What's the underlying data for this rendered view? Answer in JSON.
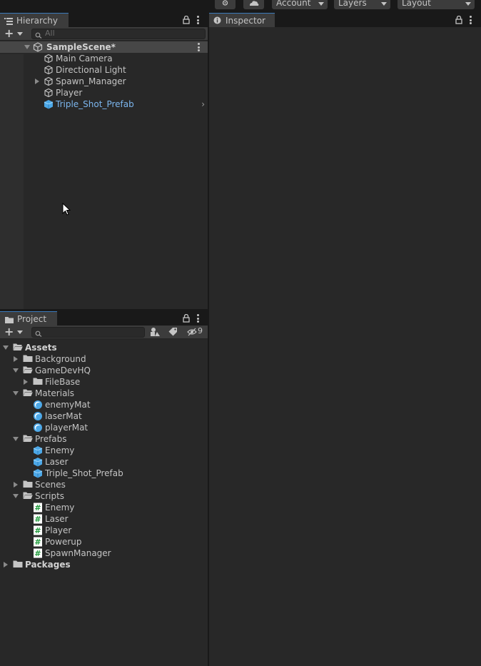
{
  "topbar": {
    "account_label": "Account",
    "layers_label": "Layers",
    "layout_label": "Layout",
    "icons": [
      "collab-icon",
      "cloud-icon"
    ]
  },
  "hierarchy": {
    "tab_label": "Hierarchy",
    "search_placeholder": "All",
    "scene_name": "SampleScene*",
    "items": [
      {
        "label": "Main Camera",
        "icon": "gameobject-icon",
        "expandable": false,
        "prefab": false
      },
      {
        "label": "Directional Light",
        "icon": "gameobject-icon",
        "expandable": false,
        "prefab": false
      },
      {
        "label": "Spawn_Manager",
        "icon": "gameobject-icon",
        "expandable": true,
        "prefab": false
      },
      {
        "label": "Player",
        "icon": "gameobject-icon",
        "expandable": false,
        "prefab": false
      },
      {
        "label": "Triple_Shot_Prefab",
        "icon": "prefab-icon",
        "expandable": false,
        "prefab": true
      }
    ]
  },
  "inspector": {
    "tab_label": "Inspector"
  },
  "project": {
    "tab_label": "Project",
    "hidden_count": "9",
    "tree": [
      {
        "label": "Assets",
        "depth": 0,
        "type": "folder-open",
        "fold": "down",
        "bold": true
      },
      {
        "label": "Background",
        "depth": 1,
        "type": "folder",
        "fold": "right"
      },
      {
        "label": "GameDevHQ",
        "depth": 1,
        "type": "folder-open",
        "fold": "down"
      },
      {
        "label": "FileBase",
        "depth": 2,
        "type": "folder",
        "fold": "right"
      },
      {
        "label": "Materials",
        "depth": 1,
        "type": "folder-open",
        "fold": "down"
      },
      {
        "label": "enemyMat",
        "depth": 2,
        "type": "material"
      },
      {
        "label": "laserMat",
        "depth": 2,
        "type": "material"
      },
      {
        "label": "playerMat",
        "depth": 2,
        "type": "material"
      },
      {
        "label": "Prefabs",
        "depth": 1,
        "type": "folder-open",
        "fold": "down"
      },
      {
        "label": "Enemy",
        "depth": 2,
        "type": "prefab"
      },
      {
        "label": "Laser",
        "depth": 2,
        "type": "prefab"
      },
      {
        "label": "Triple_Shot_Prefab",
        "depth": 2,
        "type": "prefab"
      },
      {
        "label": "Scenes",
        "depth": 1,
        "type": "folder",
        "fold": "right"
      },
      {
        "label": "Scripts",
        "depth": 1,
        "type": "folder-open",
        "fold": "down"
      },
      {
        "label": "Enemy",
        "depth": 2,
        "type": "script"
      },
      {
        "label": "Laser",
        "depth": 2,
        "type": "script"
      },
      {
        "label": "Player",
        "depth": 2,
        "type": "script"
      },
      {
        "label": "Powerup",
        "depth": 2,
        "type": "script"
      },
      {
        "label": "SpawnManager",
        "depth": 2,
        "type": "script"
      },
      {
        "label": "Packages",
        "depth": 0,
        "type": "folder",
        "fold": "right",
        "bold": true
      }
    ]
  },
  "colors": {
    "panel_bg": "#282828",
    "tab_bg": "#3c3c3c",
    "accent_blue": "#3a79bb",
    "prefab_blue": "#7cb6ee",
    "text": "#c4c4c4"
  }
}
